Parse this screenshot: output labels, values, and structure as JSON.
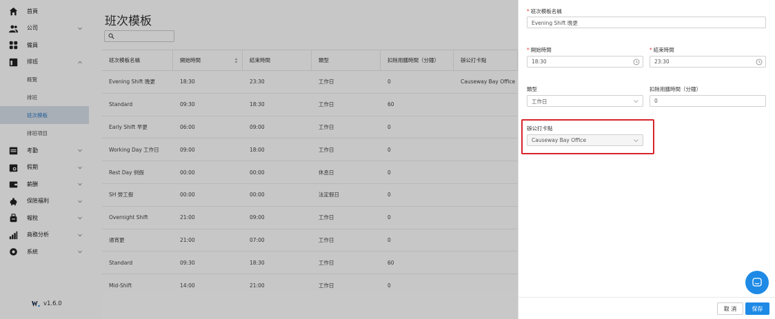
{
  "sidebar": {
    "items": [
      {
        "label": "首頁",
        "icon": "home-icon",
        "chevron": ""
      },
      {
        "label": "公司",
        "icon": "people-icon",
        "chevron": "down"
      },
      {
        "label": "僱員",
        "icon": "grid-icon",
        "chevron": ""
      },
      {
        "label": "排班",
        "icon": "schedule-icon",
        "chevron": "up"
      }
    ],
    "sub_items": [
      {
        "label": "概覽",
        "active": false
      },
      {
        "label": "排班",
        "active": false
      },
      {
        "label": "班次模板",
        "active": true
      },
      {
        "label": "排班項目",
        "active": false
      }
    ],
    "items_after": [
      {
        "label": "考勤",
        "icon": "calendar-icon",
        "chevron": "down"
      },
      {
        "label": "假期",
        "icon": "leave-icon",
        "chevron": "down"
      },
      {
        "label": "薪酬",
        "icon": "wallet-icon",
        "chevron": "down"
      },
      {
        "label": "保險福利",
        "icon": "piggy-bank-icon",
        "chevron": "down"
      },
      {
        "label": "報稅",
        "icon": "tax-icon",
        "chevron": "down"
      },
      {
        "label": "商務分析",
        "icon": "bar-chart-icon",
        "chevron": "down"
      },
      {
        "label": "系統",
        "icon": "settings-icon",
        "chevron": "down"
      }
    ],
    "version": "v1.6.0"
  },
  "main": {
    "title": "班次模板",
    "search": {
      "value": "",
      "placeholder": ""
    },
    "table": {
      "columns": [
        "班次模板名稱",
        "開始時間",
        "結束時間",
        "類型",
        "扣除用膳時間（分鐘）",
        "辦公打卡點"
      ],
      "rows": [
        [
          "Evening Shift 晚更",
          "18:30",
          "23:30",
          "工作日",
          "0",
          "Causeway Bay Office"
        ],
        [
          "Standard",
          "09:30",
          "18:30",
          "工作日",
          "60",
          ""
        ],
        [
          "Early Shift 早更",
          "06:00",
          "09:00",
          "工作日",
          "0",
          ""
        ],
        [
          "Working Day 工作日",
          "09:00",
          "18:00",
          "工作日",
          "0",
          ""
        ],
        [
          "Rest Day 例假",
          "00:00",
          "00:00",
          "休息日",
          "0",
          ""
        ],
        [
          "SH 勞工假",
          "00:00",
          "00:00",
          "法定假日",
          "0",
          ""
        ],
        [
          "Overnight Shift",
          "21:00",
          "09:00",
          "工作日",
          "0",
          ""
        ],
        [
          "通宵更",
          "21:00",
          "07:00",
          "工作日",
          "0",
          ""
        ],
        [
          "Standard",
          "09:30",
          "18:30",
          "工作日",
          "60",
          ""
        ],
        [
          "Mid-Shift",
          "14:00",
          "21:00",
          "工作日",
          "0",
          ""
        ]
      ]
    }
  },
  "drawer": {
    "name_label": "班次模板名稱",
    "name_value": "Evening Shift 晚更",
    "start_label": "開始時間",
    "start_value": "18:30",
    "end_label": "結束時間",
    "end_value": "23:30",
    "type_label": "類型",
    "type_value": "工作日",
    "meal_label": "扣除用膳時間（分鐘）",
    "meal_value": "0",
    "office_label": "辦公打卡點",
    "office_value": "Causeway Bay Office",
    "cancel_label": "取 消",
    "save_label": "保存"
  },
  "colors": {
    "accent": "#1e8ae6",
    "required": "#e2363b",
    "highlight_border": "#d8232a",
    "active_menu_bg": "#d9e1ea",
    "active_menu_text": "#2f7bc4"
  }
}
